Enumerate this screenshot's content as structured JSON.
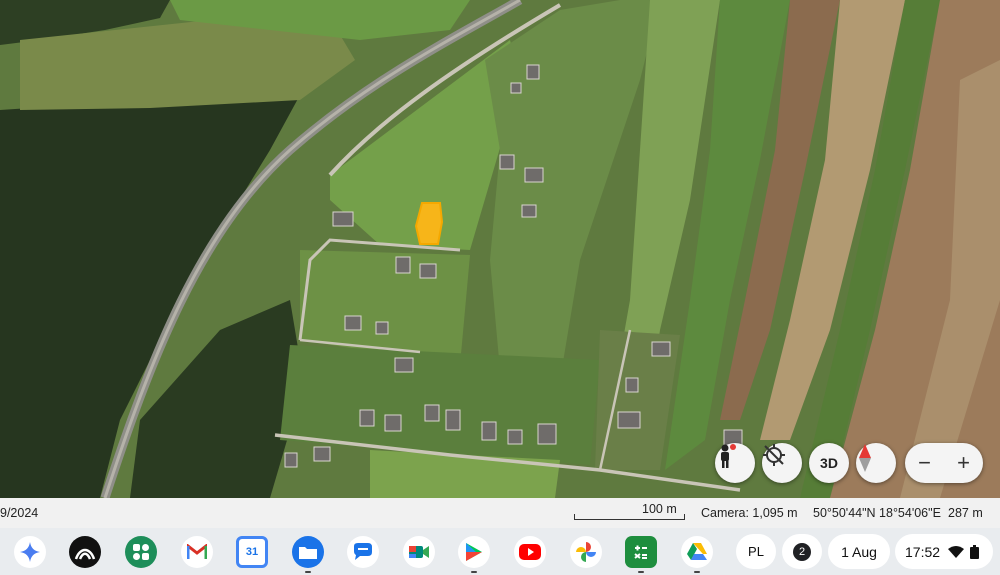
{
  "map": {
    "highlight_color": "#f7b519",
    "layers": [
      "forest",
      "farmland-strips",
      "railway",
      "road",
      "houses"
    ]
  },
  "controls": {
    "pegman_icon": "pegman-icon",
    "orient_icon": "reset-orientation-icon",
    "three_d_label": "3D",
    "compass_icon": "compass-icon",
    "zoom_out_label": "−",
    "zoom_in_label": "+"
  },
  "status": {
    "date_fragment": "9/2024",
    "scale_label": "100 m",
    "camera": "Camera: 1,095 m",
    "coordinates": "50°50'44\"N 18°54'06\"E",
    "elevation": "287 m"
  },
  "shelf": {
    "apps": [
      {
        "name": "Gemini",
        "icon": "gemini-icon"
      },
      {
        "name": "Audible",
        "icon": "audible-icon"
      },
      {
        "name": "Apps",
        "icon": "apps-icon"
      },
      {
        "name": "Gmail",
        "icon": "gmail-icon"
      },
      {
        "name": "Calendar",
        "icon": "calendar-icon",
        "glyph": "31"
      },
      {
        "name": "Files",
        "icon": "files-icon"
      },
      {
        "name": "Messages",
        "icon": "messages-icon"
      },
      {
        "name": "Meet",
        "icon": "meet-icon"
      },
      {
        "name": "Play Store",
        "icon": "play-store-icon"
      },
      {
        "name": "YouTube",
        "icon": "youtube-icon"
      },
      {
        "name": "Photos",
        "icon": "photos-icon"
      },
      {
        "name": "Calculator",
        "icon": "calculator-icon"
      },
      {
        "name": "Drive",
        "icon": "drive-icon"
      }
    ],
    "language": "PL",
    "notification_count": "2",
    "date": "1 Aug",
    "time": "17:52"
  }
}
